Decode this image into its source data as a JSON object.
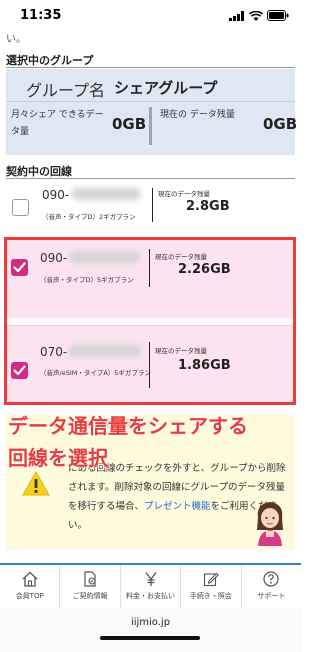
{
  "status": {
    "time": "11:35"
  },
  "top_fragment": "い。",
  "group_section": {
    "heading": "選択中のグループ",
    "name_label": "グループ名",
    "name_value": "シェアグループ",
    "share_label": "月々シェア できるデータ量",
    "share_value": "0GB",
    "remain_label": "現在の データ残量",
    "remain_value": "0GB"
  },
  "lines_section": {
    "heading": "契約中の回線",
    "lines": [
      {
        "number": "090-",
        "plan": "（音声・タイプD）2ギガプラン",
        "remain_label": "現在のデータ残量",
        "remain_value": "2.8GB",
        "checked": false
      },
      {
        "number": "090-",
        "plan": "（音声・タイプD）5ギガプラン",
        "remain_label": "現在のデータ残量",
        "remain_value": "2.26GB",
        "checked": true
      },
      {
        "number": "070-",
        "plan": "（音声/eSIM・タイプA）5ギガプラン",
        "remain_label": "現在のデータ残量",
        "remain_value": "1.86GB",
        "checked": true
      }
    ]
  },
  "overlay": {
    "line1": "データ通信量をシェアする",
    "line2": "回線を選択"
  },
  "info": {
    "faded_header": "ご注意事項",
    "text_before_link": "にある回線のチェックを外すと、グループから削除されます。削除対象の回線にグループのデータ残量を移行する場合、",
    "link": "プレゼント機能",
    "text_after_link": "をご利用ください。"
  },
  "nav": [
    {
      "label": "会員TOP",
      "icon": "home-icon"
    },
    {
      "label": "ご契約情報",
      "icon": "contract-icon"
    },
    {
      "label": "料金・お支払い",
      "icon": "yen-icon"
    },
    {
      "label": "手続き・照会",
      "icon": "edit-icon"
    },
    {
      "label": "サポート",
      "icon": "help-icon"
    }
  ],
  "url": "iijmio.jp",
  "colors": {
    "accent": "#cf2f80",
    "highlight": "#ea3c3c",
    "link": "#2a6ad8",
    "nav_border": "#3a7bd5"
  }
}
